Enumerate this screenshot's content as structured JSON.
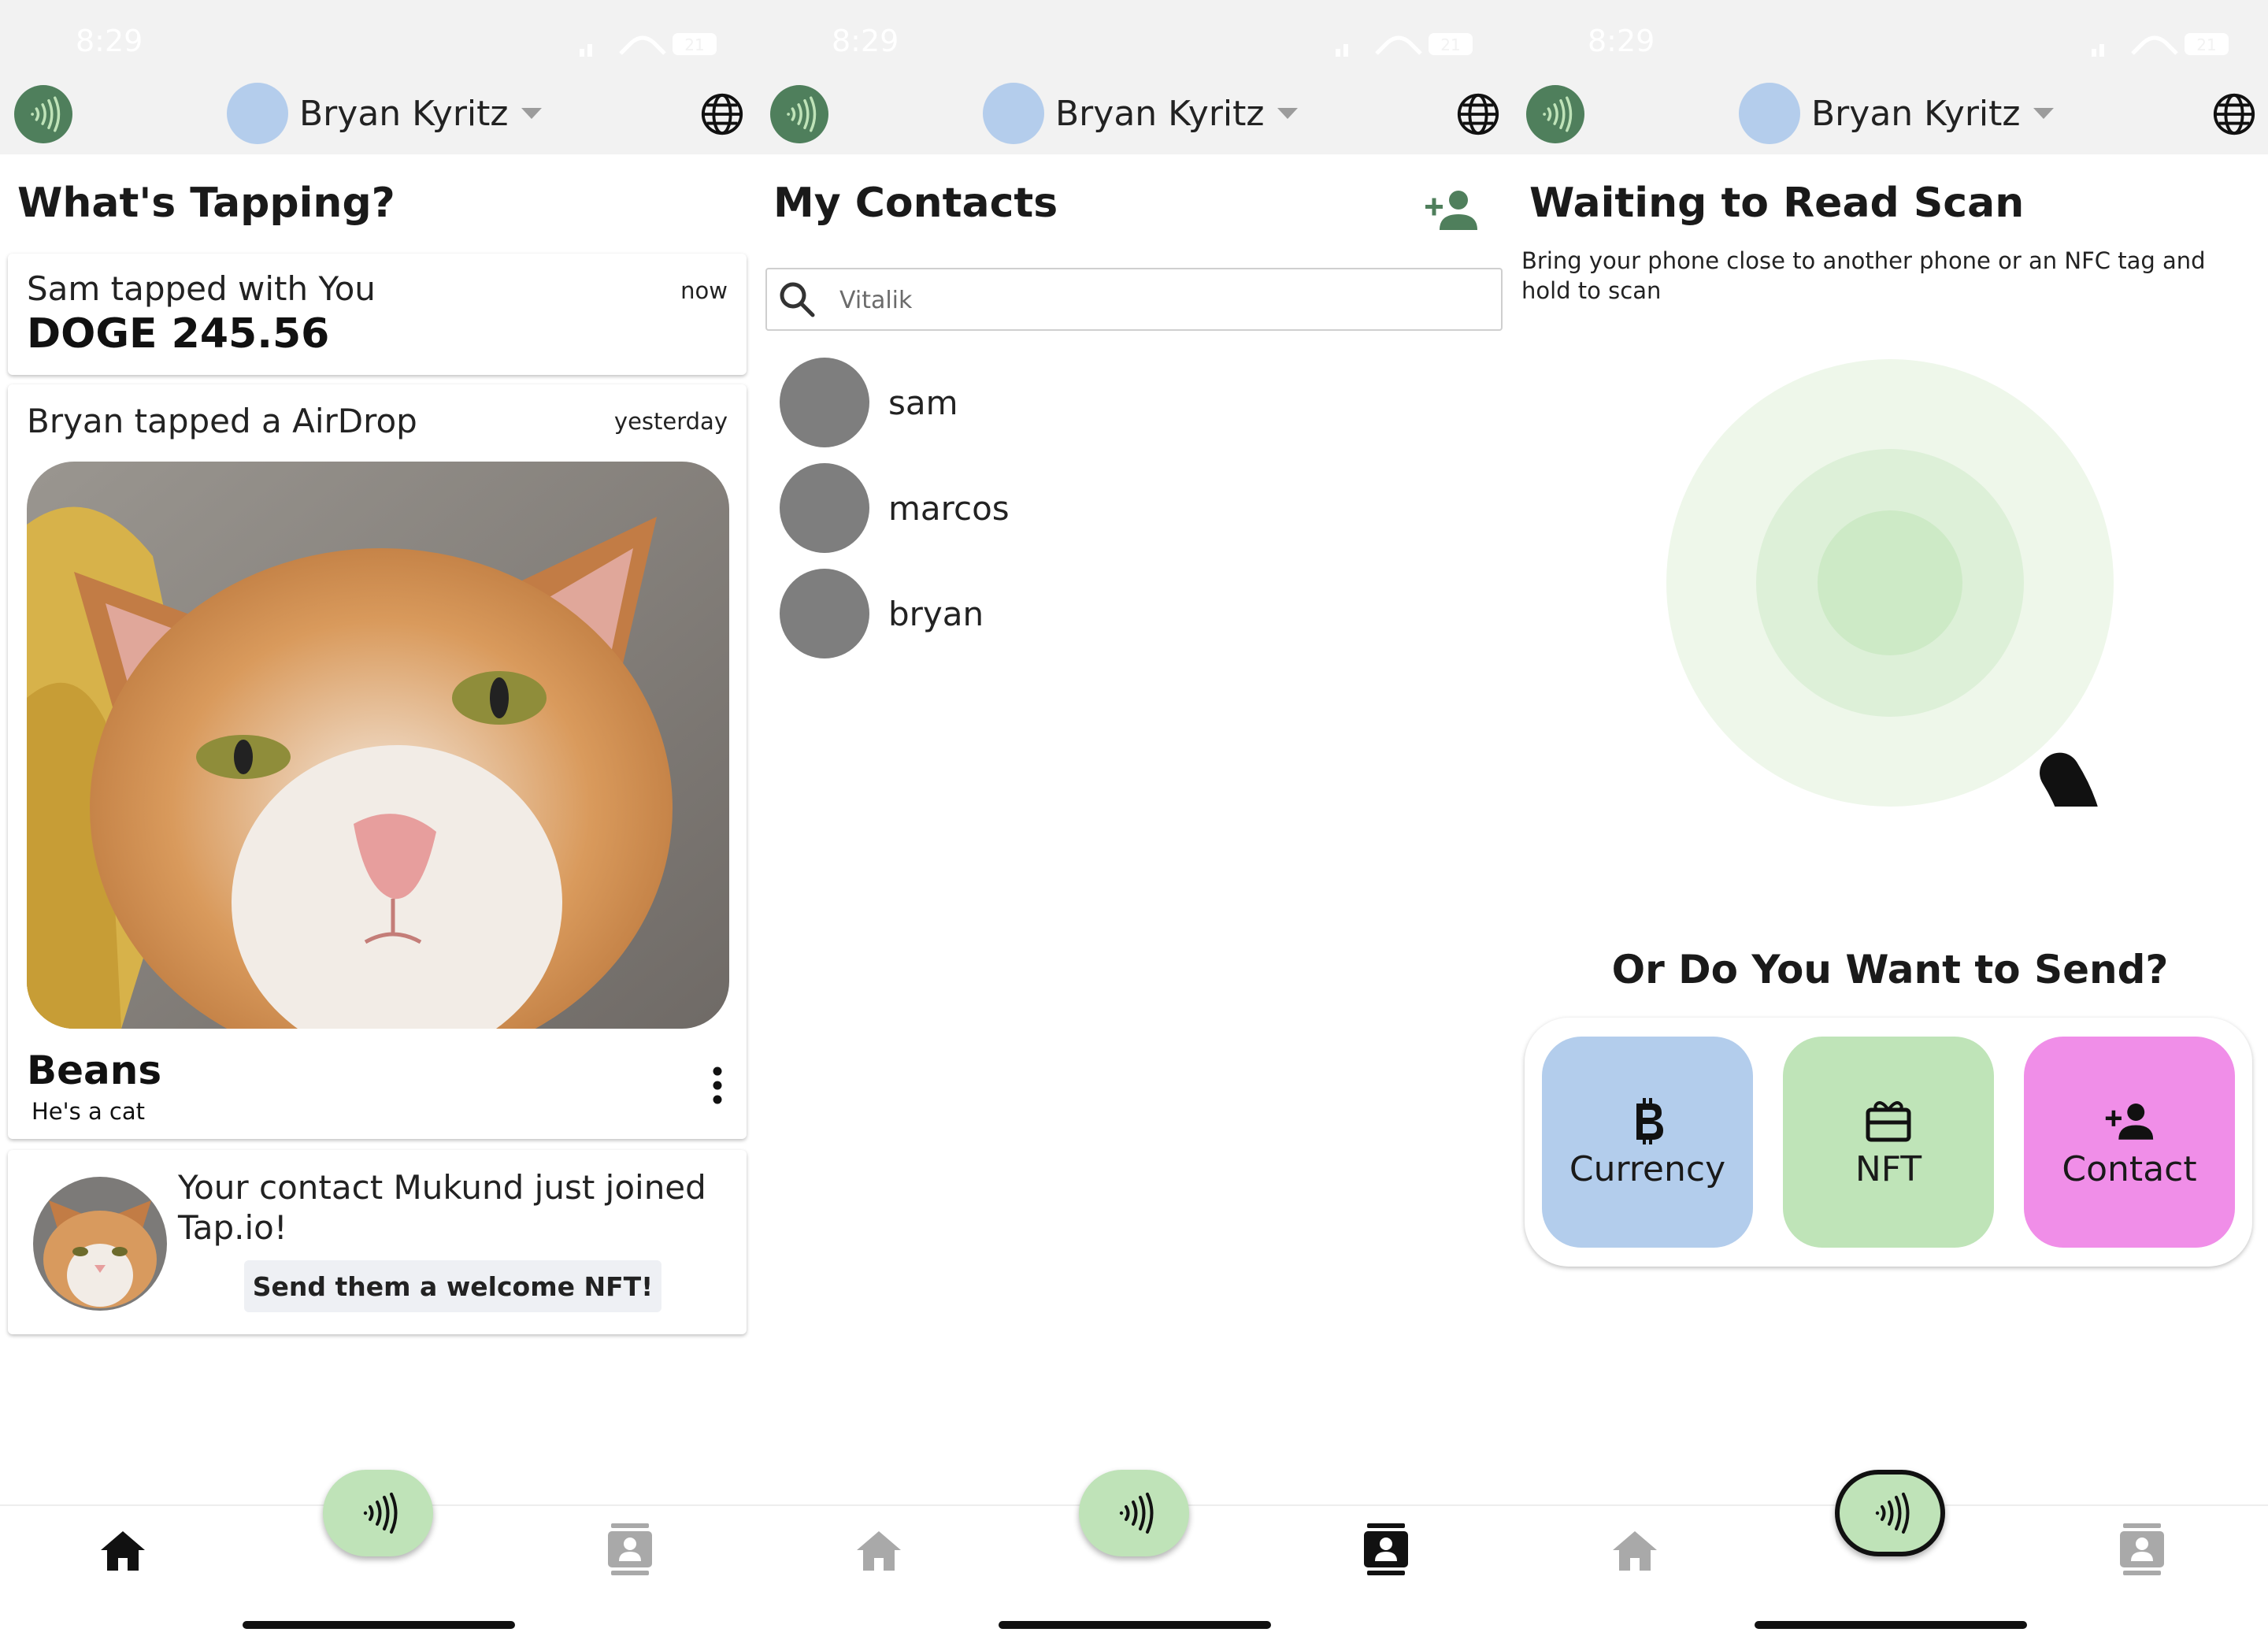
{
  "status_bar": {
    "time": "8:29",
    "battery": "21"
  },
  "header": {
    "user_name": "Bryan Kyritz"
  },
  "home": {
    "title": "What's Tapping?",
    "feed": [
      {
        "text": "Sam tapped with You",
        "time": "now",
        "amount": "DOGE 245.56"
      },
      {
        "text": "Bryan tapped a AirDrop",
        "time": "yesterday",
        "nft_name": "Beans",
        "nft_description": "He's a cat"
      },
      {
        "text": "Your contact Mukund just joined Tap.io!",
        "button": "Send them a welcome NFT!"
      }
    ]
  },
  "contacts": {
    "title": "My Contacts",
    "search": {
      "value": "",
      "placeholder": "Vitalik"
    },
    "list": [
      "sam",
      "marcos",
      "bryan"
    ]
  },
  "scan": {
    "title": "Waiting to Read Scan",
    "subtitle": "Bring your phone close to another phone or an NFC tag and hold to scan",
    "send_title": "Or Do You Want to Send?",
    "options": [
      {
        "label": "Currency",
        "icon": "bitcoin-icon",
        "color": "#b3cdec"
      },
      {
        "label": "NFT",
        "icon": "gift-card-icon",
        "color": "#bfe4b8"
      },
      {
        "label": "Contact",
        "icon": "person-add-icon",
        "color": "#f08ee8"
      }
    ]
  },
  "colors": {
    "brand_green": "#4f7f5c",
    "fab_green": "#bfe3b8",
    "scan_ring_outer": "#eef7ea",
    "scan_ring_mid": "#ddf0d8",
    "scan_ring_inner": "#cdeac6",
    "avatar_blue": "#b4cdec",
    "contact_gray": "#7e7e7e"
  }
}
